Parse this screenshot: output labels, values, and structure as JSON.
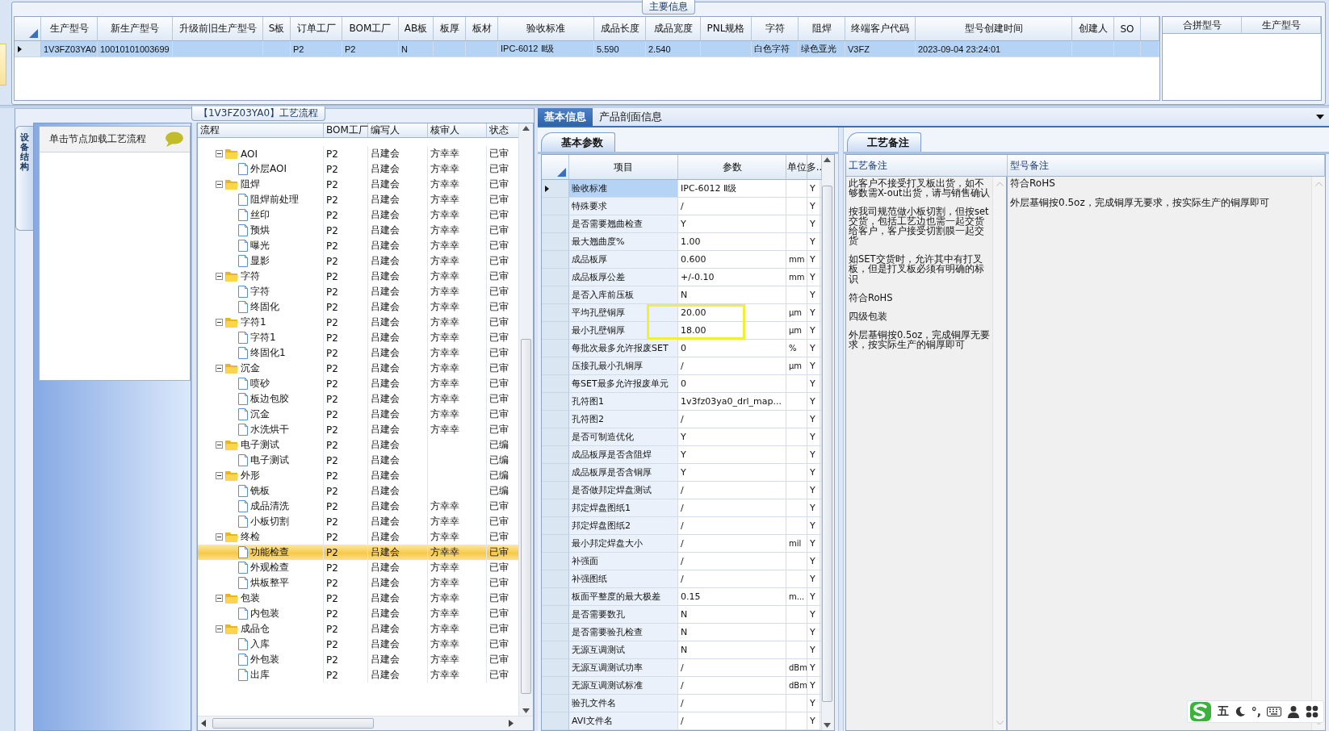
{
  "main_info": {
    "title": "主要信息",
    "columns": [
      "生产型号",
      "新生产型号",
      "升级前旧生产型号",
      "S板",
      "订单工厂",
      "BOM工厂",
      "AB板",
      "板厚",
      "板材",
      "验收标准",
      "成品长度",
      "成品宽度",
      "PNL规格",
      "字符",
      "阻焊",
      "终端客户代码",
      "型号创建时间",
      "创建人",
      "SO"
    ],
    "rows": [
      {
        "selected": true,
        "cells": [
          {
            "text": "1V3FZ03YA0"
          },
          {
            "text": "10010101003699"
          },
          {},
          {},
          {
            "text": "P2"
          },
          {
            "text": "P2"
          },
          {
            "text": "N"
          },
          {},
          {},
          {
            "text": "IPC-6012 Ⅱ级"
          },
          {
            "text": "5.590"
          },
          {
            "text": "2.540"
          },
          {},
          {
            "text": "白色字符"
          },
          {
            "text": "绿色亚光"
          },
          {
            "text": "V3FZ"
          },
          {
            "text": "2023-09-04 23:24:01"
          },
          {},
          {}
        ]
      }
    ]
  },
  "merge_grid": {
    "columns": [
      "合拼型号",
      "生产型号"
    ]
  },
  "process": {
    "title": "【1V3FZ03YA0】工艺流程",
    "side_tab": "设备结构",
    "hint": "单击节点加载工艺流程",
    "tree": {
      "columns": [
        "流程",
        "BOM工厂",
        "编写人",
        "核审人",
        "状态"
      ],
      "nodes": [
        {
          "name": "AOI",
          "factory": "P2",
          "writer": "吕建会",
          "reviewer": "方幸幸",
          "status": "已审",
          "selected": false,
          "expanded": true,
          "children": [
            {
              "name": "外层AOI",
              "factory": "P2",
              "writer": "吕建会",
              "reviewer": "方幸幸",
              "status": "已审",
              "selected": false
            }
          ]
        },
        {
          "name": "阻焊",
          "factory": "P2",
          "writer": "吕建会",
          "reviewer": "方幸幸",
          "status": "已审",
          "selected": false,
          "expanded": true,
          "children": [
            {
              "name": "阻焊前处理",
              "factory": "P2",
              "writer": "吕建会",
              "reviewer": "方幸幸",
              "status": "已审",
              "selected": false
            },
            {
              "name": "丝印",
              "factory": "P2",
              "writer": "吕建会",
              "reviewer": "方幸幸",
              "status": "已审",
              "selected": false
            },
            {
              "name": "预烘",
              "factory": "P2",
              "writer": "吕建会",
              "reviewer": "方幸幸",
              "status": "已审",
              "selected": false
            },
            {
              "name": "曝光",
              "factory": "P2",
              "writer": "吕建会",
              "reviewer": "方幸幸",
              "status": "已审",
              "selected": false
            },
            {
              "name": "显影",
              "factory": "P2",
              "writer": "吕建会",
              "reviewer": "方幸幸",
              "status": "已审",
              "selected": false
            }
          ]
        },
        {
          "name": "字符",
          "factory": "P2",
          "writer": "吕建会",
          "reviewer": "方幸幸",
          "status": "已审",
          "selected": false,
          "expanded": true,
          "children": [
            {
              "name": "字符",
              "factory": "P2",
              "writer": "吕建会",
              "reviewer": "方幸幸",
              "status": "已审",
              "selected": false
            },
            {
              "name": "终固化",
              "factory": "P2",
              "writer": "吕建会",
              "reviewer": "方幸幸",
              "status": "已审",
              "selected": false
            }
          ]
        },
        {
          "name": "字符1",
          "factory": "P2",
          "writer": "吕建会",
          "reviewer": "方幸幸",
          "status": "已审",
          "selected": false,
          "expanded": true,
          "children": [
            {
              "name": "字符1",
              "factory": "P2",
              "writer": "吕建会",
              "reviewer": "方幸幸",
              "status": "已审",
              "selected": false
            },
            {
              "name": "终固化1",
              "factory": "P2",
              "writer": "吕建会",
              "reviewer": "方幸幸",
              "status": "已审",
              "selected": false
            }
          ]
        },
        {
          "name": "沉金",
          "factory": "P2",
          "writer": "吕建会",
          "reviewer": "方幸幸",
          "status": "已审",
          "selected": false,
          "expanded": true,
          "children": [
            {
              "name": "喷砂",
              "factory": "P2",
              "writer": "吕建会",
              "reviewer": "方幸幸",
              "status": "已审",
              "selected": false
            },
            {
              "name": "板边包胶",
              "factory": "P2",
              "writer": "吕建会",
              "reviewer": "方幸幸",
              "status": "已审",
              "selected": false
            },
            {
              "name": "沉金",
              "factory": "P2",
              "writer": "吕建会",
              "reviewer": "方幸幸",
              "status": "已审",
              "selected": false
            },
            {
              "name": "水洗烘干",
              "factory": "P2",
              "writer": "吕建会",
              "reviewer": "方幸幸",
              "status": "已审",
              "selected": false
            }
          ]
        },
        {
          "name": "电子测试",
          "factory": "P2",
          "writer": "吕建会",
          "status": "已编",
          "selected": false,
          "expanded": true,
          "children": [
            {
              "name": "电子测试",
              "factory": "P2",
              "writer": "吕建会",
              "status": "已编",
              "selected": false
            }
          ]
        },
        {
          "name": "外形",
          "factory": "P2",
          "writer": "吕建会",
          "status": "已编",
          "selected": false,
          "expanded": true,
          "children": [
            {
              "name": "铣板",
              "factory": "P2",
              "writer": "吕建会",
              "status": "已编",
              "selected": false
            },
            {
              "name": "成品清洗",
              "factory": "P2",
              "writer": "吕建会",
              "reviewer": "方幸幸",
              "status": "已审",
              "selected": false
            },
            {
              "name": "小板切割",
              "factory": "P2",
              "writer": "吕建会",
              "reviewer": "方幸幸",
              "status": "已审",
              "selected": false
            }
          ]
        },
        {
          "name": "终检",
          "factory": "P2",
          "writer": "吕建会",
          "reviewer": "方幸幸",
          "status": "已审",
          "selected": false,
          "expanded": true,
          "children": [
            {
              "name": "功能检查",
              "factory": "P2",
              "writer": "吕建会",
              "reviewer": "方幸幸",
              "status": "已审",
              "selected": true
            },
            {
              "name": "外观检查",
              "factory": "P2",
              "writer": "吕建会",
              "reviewer": "方幸幸",
              "status": "已审",
              "selected": false
            },
            {
              "name": "烘板整平",
              "factory": "P2",
              "writer": "吕建会",
              "reviewer": "方幸幸",
              "status": "已审",
              "selected": false
            }
          ]
        },
        {
          "name": "包装",
          "factory": "P2",
          "writer": "吕建会",
          "reviewer": "方幸幸",
          "status": "已审",
          "selected": false,
          "expanded": true,
          "children": [
            {
              "name": "内包装",
              "factory": "P2",
              "writer": "吕建会",
              "reviewer": "方幸幸",
              "status": "已审",
              "selected": false
            }
          ]
        },
        {
          "name": "成品仓",
          "factory": "P2",
          "writer": "吕建会",
          "reviewer": "方幸幸",
          "status": "已审",
          "selected": false,
          "expanded": true,
          "children": [
            {
              "name": "入库",
              "factory": "P2",
              "writer": "吕建会",
              "reviewer": "方幸幸",
              "status": "已审",
              "selected": false
            },
            {
              "name": "外包装",
              "factory": "P2",
              "writer": "吕建会",
              "reviewer": "方幸幸",
              "status": "已审",
              "selected": false
            },
            {
              "name": "出库",
              "factory": "P2",
              "writer": "吕建会",
              "reviewer": "方幸幸",
              "status": "已审",
              "selected": false
            }
          ]
        }
      ]
    }
  },
  "tabs": [
    {
      "label": "基本信息",
      "selected": true
    },
    {
      "label": "产品剖面信息",
      "selected": false
    }
  ],
  "params": {
    "tab": "基本参数",
    "columns": [
      "项目",
      "参数",
      "单位",
      "多.."
    ],
    "rows": [
      {
        "item": "验收标准",
        "value": "IPC-6012 Ⅱ级",
        "flag": "Y",
        "selected": true,
        "boxed": false
      },
      {
        "item": "特殊要求",
        "value": "/",
        "flag": "Y",
        "selected": false,
        "boxed": false
      },
      {
        "item": "是否需要翘曲检查",
        "value": "Y",
        "flag": "Y",
        "selected": false,
        "boxed": false
      },
      {
        "item": "最大翘曲度%",
        "value": "1.00",
        "flag": "Y",
        "selected": false,
        "boxed": false
      },
      {
        "item": "成品板厚",
        "value": "0.600",
        "unit": "mm",
        "flag": "Y",
        "selected": false,
        "boxed": false
      },
      {
        "item": "成品板厚公差",
        "value": "+/-0.10",
        "unit": "mm",
        "flag": "Y",
        "selected": false,
        "boxed": false
      },
      {
        "item": "是否入库前压板",
        "value": "N",
        "flag": "Y",
        "selected": false,
        "boxed": false
      },
      {
        "item": "平均孔壁铜厚",
        "value": "20.00",
        "unit": "μm",
        "flag": "Y",
        "selected": false,
        "boxed": true
      },
      {
        "item": "最小孔壁铜厚",
        "value": "18.00",
        "unit": "μm",
        "flag": "Y",
        "selected": false,
        "boxed": true
      },
      {
        "item": "每批次最多允许报废SET",
        "value": "0",
        "unit": "%",
        "flag": "Y",
        "selected": false,
        "boxed": false
      },
      {
        "item": "压接孔最小孔铜厚",
        "value": "/",
        "unit": "μm",
        "flag": "Y",
        "selected": false,
        "boxed": false
      },
      {
        "item": "每SET最多允许报废单元",
        "value": "0",
        "flag": "Y",
        "selected": false,
        "boxed": false
      },
      {
        "item": "孔符图1",
        "value": "1v3fz03ya0_drl_map...",
        "flag": "Y",
        "selected": false,
        "boxed": false
      },
      {
        "item": "孔符图2",
        "value": "/",
        "flag": "Y",
        "selected": false,
        "boxed": false
      },
      {
        "item": "是否可制造优化",
        "value": "Y",
        "flag": "Y",
        "selected": false,
        "boxed": false
      },
      {
        "item": "成品板厚是否含阻焊",
        "value": "Y",
        "flag": "Y",
        "selected": false,
        "boxed": false
      },
      {
        "item": "成品板厚是否含铜厚",
        "value": "Y",
        "flag": "Y",
        "selected": false,
        "boxed": false
      },
      {
        "item": "是否做邦定焊盘测试",
        "value": "/",
        "flag": "Y",
        "selected": false,
        "boxed": false
      },
      {
        "item": "邦定焊盘图纸1",
        "value": "/",
        "flag": "Y",
        "selected": false,
        "boxed": false
      },
      {
        "item": "邦定焊盘图纸2",
        "value": "/",
        "flag": "Y",
        "selected": false,
        "boxed": false
      },
      {
        "item": "最小邦定焊盘大小",
        "value": "/",
        "unit": "mil",
        "flag": "Y",
        "selected": false,
        "boxed": false
      },
      {
        "item": "补强面",
        "value": "/",
        "flag": "Y",
        "selected": false,
        "boxed": false
      },
      {
        "item": "补强图纸",
        "value": "/",
        "flag": "Y",
        "selected": false,
        "boxed": false
      },
      {
        "item": "板面平整度的最大极差",
        "value": "0.15",
        "unit": "m...",
        "flag": "Y",
        "selected": false,
        "boxed": false
      },
      {
        "item": "是否需要数孔",
        "value": "N",
        "flag": "Y",
        "selected": false,
        "boxed": false
      },
      {
        "item": "是否需要验孔检查",
        "value": "N",
        "flag": "Y",
        "selected": false,
        "boxed": false
      },
      {
        "item": "无源互调测试",
        "value": "N",
        "flag": "Y",
        "selected": false,
        "boxed": false
      },
      {
        "item": "无源互调测试功率",
        "value": "/",
        "unit": "dBm",
        "flag": "Y",
        "selected": false,
        "boxed": false
      },
      {
        "item": "无源互调测试标准",
        "value": "/",
        "unit": "dBm",
        "flag": "Y",
        "selected": false,
        "boxed": false
      },
      {
        "item": "验孔文件名",
        "value": "/",
        "flag": "Y",
        "selected": false,
        "boxed": false
      },
      {
        "item": "AVI文件名",
        "value": "/",
        "flag": "Y",
        "selected": false,
        "boxed": false
      }
    ]
  },
  "notes": {
    "tab": "工艺备注",
    "columns": [
      "工艺备注",
      "型号备注"
    ],
    "process_notes": [
      "此客户不接受打叉板出货，如不够数需X-out出货，请与销售确认",
      "按我司规范做小板切割，但按set交货，包括工艺边也需一起交货给客户，客户接受切割膜一起交货",
      "如SET交货时，允许其中有打叉板，但是打叉板必须有明确的标识",
      "符合RoHS",
      "四级包装",
      "外层基铜按0.5oz，完成铜厚无要求，按实际生产的铜厚即可"
    ],
    "model_notes": [
      "符合RoHS",
      "外层基铜按0.5oz，完成铜厚无要求，按实际生产的铜厚即可"
    ]
  },
  "ime_bar": {
    "mode": "五",
    "punct": "°,"
  }
}
